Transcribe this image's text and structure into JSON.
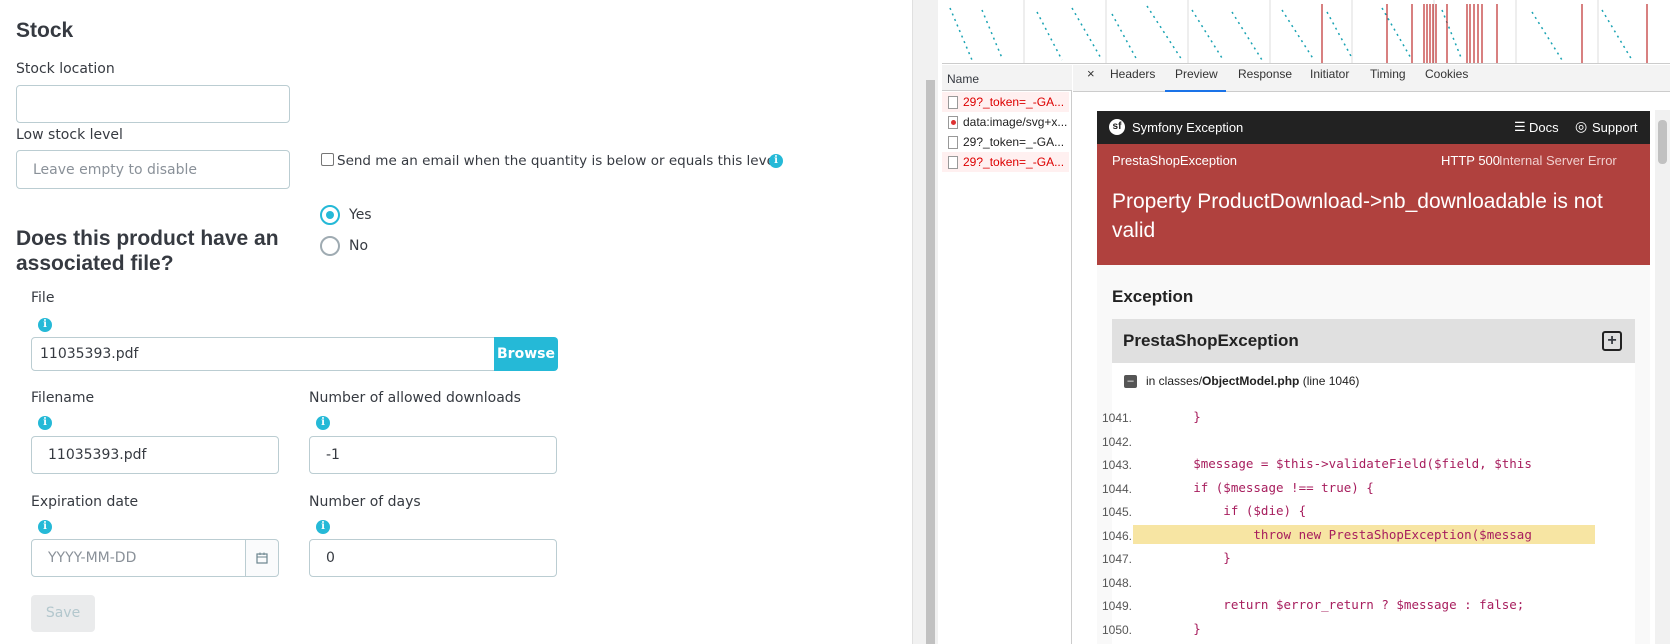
{
  "form": {
    "stock_heading": "Stock",
    "stock_location_label": "Stock location",
    "stock_location_value": "",
    "low_stock_label": "Low stock level",
    "low_stock_placeholder": "Leave empty to disable",
    "email_alert_label": "Send me an email when the quantity is below or equals this level",
    "email_alert_checked": false,
    "file_question": "Does this product have an associated file?",
    "radio_yes": "Yes",
    "radio_no": "No",
    "radio_selected": "Yes",
    "file_label": "File",
    "file_value": "11035393.pdf",
    "browse_label": "Browse",
    "filename_label": "Filename",
    "filename_value": "11035393.pdf",
    "allowed_downloads_label": "Number of allowed downloads",
    "allowed_downloads_value": "-1",
    "expiration_label": "Expiration date",
    "expiration_placeholder": "YYYY-MM-DD",
    "days_label": "Number of days",
    "days_value": "0",
    "save_label": "Save",
    "info_glyph": "i"
  },
  "devtools": {
    "name_header": "Name",
    "close_glyph": "×",
    "tabs": [
      "Headers",
      "Preview",
      "Response",
      "Initiator",
      "Timing",
      "Cookies"
    ],
    "active_tab": "Preview",
    "requests": [
      {
        "name": "29?_token=_-GA...",
        "error": true
      },
      {
        "name": "data:image/svg+x...",
        "error": false
      },
      {
        "name": "29?_token=_-GA...",
        "error": false
      },
      {
        "name": "29?_token=_-GA...",
        "error": true
      }
    ]
  },
  "exception": {
    "brand": "Symfony Exception",
    "docs_label": "Docs",
    "support_label": "Support",
    "class_name": "PrestaShopException",
    "http_code": "HTTP 500",
    "http_text": "Internal Server Error",
    "message": "Property ProductDownload->nb_downloadable is not valid",
    "section_title": "Exception",
    "trace_title": "PrestaShopException",
    "trace_in": "in classes/",
    "trace_file": "ObjectModel.php",
    "trace_line": "(line 1046)",
    "code_lines": [
      {
        "n": "1041.",
        "text": "        }"
      },
      {
        "n": "1042.",
        "text": ""
      },
      {
        "n": "1043.",
        "text": "        $message = $this->validateField($field, $this"
      },
      {
        "n": "1044.",
        "text": "        if ($message !== true) {"
      },
      {
        "n": "1045.",
        "text": "            if ($die) {"
      },
      {
        "n": "1046.",
        "text": "                throw new PrestaShopException($messag"
      },
      {
        "n": "1047.",
        "text": "            }"
      },
      {
        "n": "1048.",
        "text": ""
      },
      {
        "n": "1049.",
        "text": "            return $error_return ? $message : false;"
      },
      {
        "n": "1050.",
        "text": "        }"
      }
    ],
    "highlight_line": "1046."
  },
  "colors": {
    "accent": "#25b9d7",
    "error_red": "#b0413e",
    "symfony_bar": "#222222",
    "highlight": "#f7e5a3"
  }
}
